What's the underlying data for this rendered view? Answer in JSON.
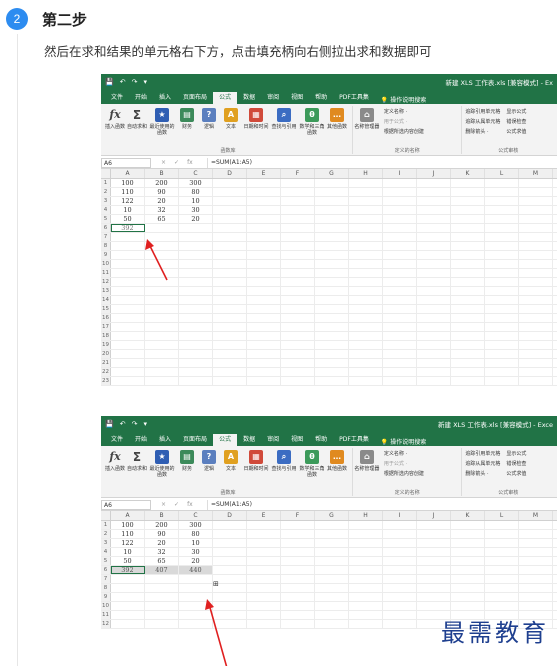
{
  "step": {
    "number": "2",
    "title": "第二步",
    "description": "然后在求和结果的单元格右下方，点击填充柄向右侧拉出求和数据即可"
  },
  "excel": {
    "doc_title": "新建 XLS 工作表.xls [兼容模式] - Ex",
    "doc_title_2": "新建 XLS 工作表.xls [兼容模式] - Exce",
    "quick_access": [
      "💾",
      "↶",
      "↷",
      "▾"
    ],
    "menu_tabs": [
      "文件",
      "开始",
      "插入",
      "页面布局",
      "公式",
      "数据",
      "审阅",
      "视图",
      "帮助",
      "PDF工具集"
    ],
    "active_tab": "公式",
    "tell_me": "操作说明搜索",
    "ribbon": {
      "func_buttons": [
        {
          "label": "插入函数",
          "icon": "fx-icon"
        },
        {
          "label": "自动求和",
          "icon": "sum-icon"
        },
        {
          "label": "最近使用的函数",
          "icon": "star-icon"
        },
        {
          "label": "财务",
          "icon": "book-icon"
        },
        {
          "label": "逻辑",
          "icon": "logic-icon"
        },
        {
          "label": "文本",
          "icon": "text-icon"
        },
        {
          "label": "日期和时间",
          "icon": "calendar-icon"
        },
        {
          "label": "查找与引用",
          "icon": "lookup-icon"
        },
        {
          "label": "数学和三角函数",
          "icon": "math-icon"
        },
        {
          "label": "其他函数",
          "icon": "more-icon"
        }
      ],
      "func_group_label": "函数库",
      "name_manager": "名称管理器",
      "names_items": [
        "定义名称 ·",
        "用于公式 ·",
        "根据所选内容创建"
      ],
      "names_group_label": "定义的名称",
      "audit_items_1": [
        "追踪引用单元格",
        "追踪从属单元格",
        "删除箭头 ·"
      ],
      "audit_items_2": [
        "显示公式",
        "错误检查",
        "公式求值"
      ],
      "audit_group_label": "公式审核"
    },
    "name_box": "A6",
    "formula": "=SUM(A1:A5)",
    "fx_symbols": [
      "×",
      "✓",
      "fx"
    ],
    "columns": [
      "A",
      "B",
      "C",
      "D",
      "E",
      "F",
      "G",
      "H",
      "I",
      "J",
      "K",
      "L",
      "M"
    ],
    "data_rows": [
      [
        "100",
        "200",
        "300"
      ],
      [
        "110",
        "90",
        "80"
      ],
      [
        "122",
        "20",
        "10"
      ],
      [
        "10",
        "32",
        "30"
      ],
      [
        "50",
        "65",
        "20"
      ]
    ],
    "sum_row_1": [
      "392",
      "",
      ""
    ],
    "sum_row_2": [
      "392",
      "407",
      "440"
    ],
    "fill_icon": "⊞"
  },
  "colors": {
    "excel_green": "#217346",
    "step_blue": "#2d8cf0",
    "arrow_red": "#e02020",
    "watermark": "#1e3f8f"
  },
  "watermark": "最需教育"
}
